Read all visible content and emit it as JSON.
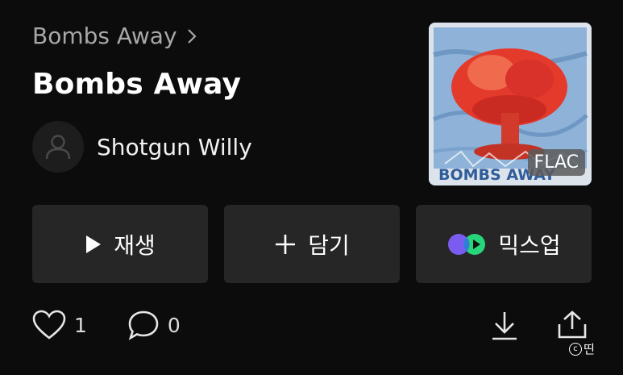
{
  "header": {
    "album_link": "Bombs Away",
    "title": "Bombs Away"
  },
  "artist": {
    "name": "Shotgun Willy"
  },
  "cover": {
    "text": "BOMBS AWAY",
    "quality_badge": "FLAC"
  },
  "actions": {
    "play_label": "재생",
    "add_label": "담기",
    "mixup_label": "믹스업"
  },
  "stats": {
    "likes": "1",
    "comments": "0"
  },
  "watermark": {
    "c": "c",
    "text": "띤"
  },
  "colors": {
    "background": "#0c0c0c",
    "button": "#262626",
    "mixup_purple": "#7b5cf0",
    "mixup_green": "#27d67b"
  }
}
